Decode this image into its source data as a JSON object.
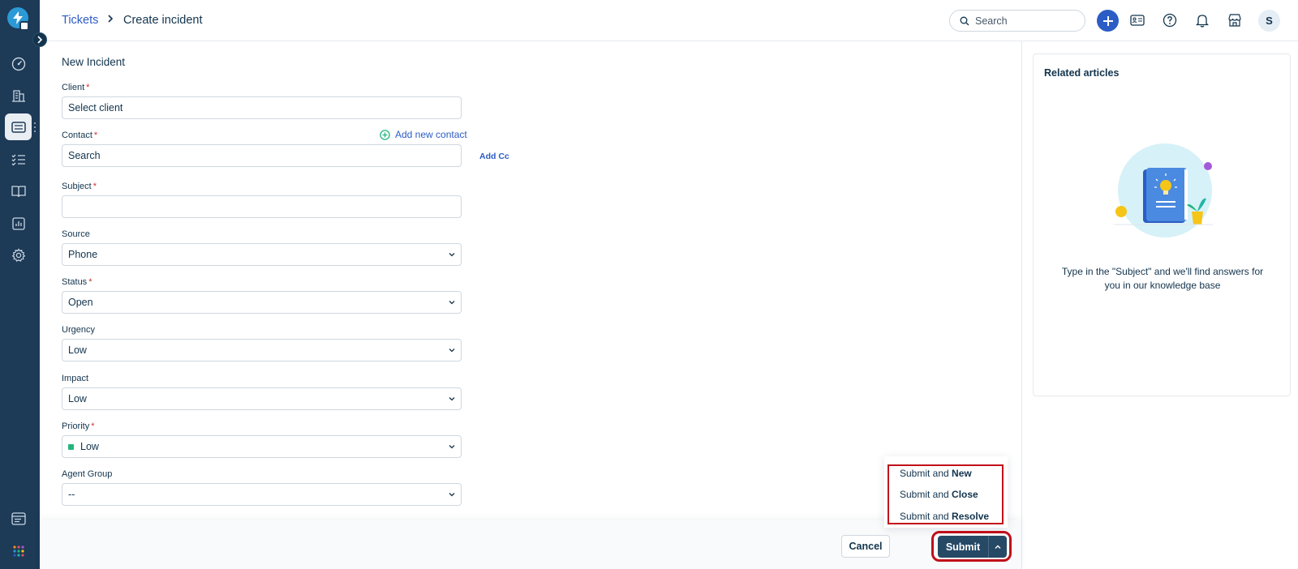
{
  "header": {
    "breadcrumb_link": "Tickets",
    "breadcrumb_current": "Create incident",
    "search_placeholder": "Search",
    "avatar_initial": "S"
  },
  "rail": {
    "items": [
      "dashboard-icon",
      "companies-icon",
      "tickets-icon",
      "tasks-icon",
      "solutions-icon",
      "analytics-icon",
      "admin-icon",
      "apps-icon",
      "marketplace-grid-icon"
    ],
    "active": "tickets-icon"
  },
  "form": {
    "title": "New Incident",
    "required_mark": "*",
    "add_new_contact": "Add new contact",
    "add_cc": "Add Cc",
    "fields": {
      "client": {
        "label": "Client",
        "value": "Select client"
      },
      "contact": {
        "label": "Contact",
        "value": "Search"
      },
      "subject": {
        "label": "Subject",
        "value": ""
      },
      "source": {
        "label": "Source",
        "value": "Phone"
      },
      "status": {
        "label": "Status",
        "value": "Open"
      },
      "urgency": {
        "label": "Urgency",
        "value": "Low"
      },
      "impact": {
        "label": "Impact",
        "value": "Low"
      },
      "priority": {
        "label": "Priority",
        "value": "Low"
      },
      "agent_group": {
        "label": "Agent Group",
        "value": "--"
      }
    }
  },
  "related": {
    "title": "Related articles",
    "hint": "Type in the \"Subject\" and we'll find answers for you in our knowledge base"
  },
  "footer": {
    "cancel": "Cancel",
    "submit": "Submit",
    "menu": [
      {
        "prefix": "Submit and ",
        "bold": "New"
      },
      {
        "prefix": "Submit and ",
        "bold": "Close"
      },
      {
        "prefix": "Submit and ",
        "bold": "Resolve"
      }
    ]
  },
  "colors": {
    "rail": "#1d3a57",
    "primary": "#2c5cc5",
    "submit": "#264966",
    "highlight": "#c00f1a",
    "priority_low": "#24b47e",
    "required": "#d72d30"
  }
}
